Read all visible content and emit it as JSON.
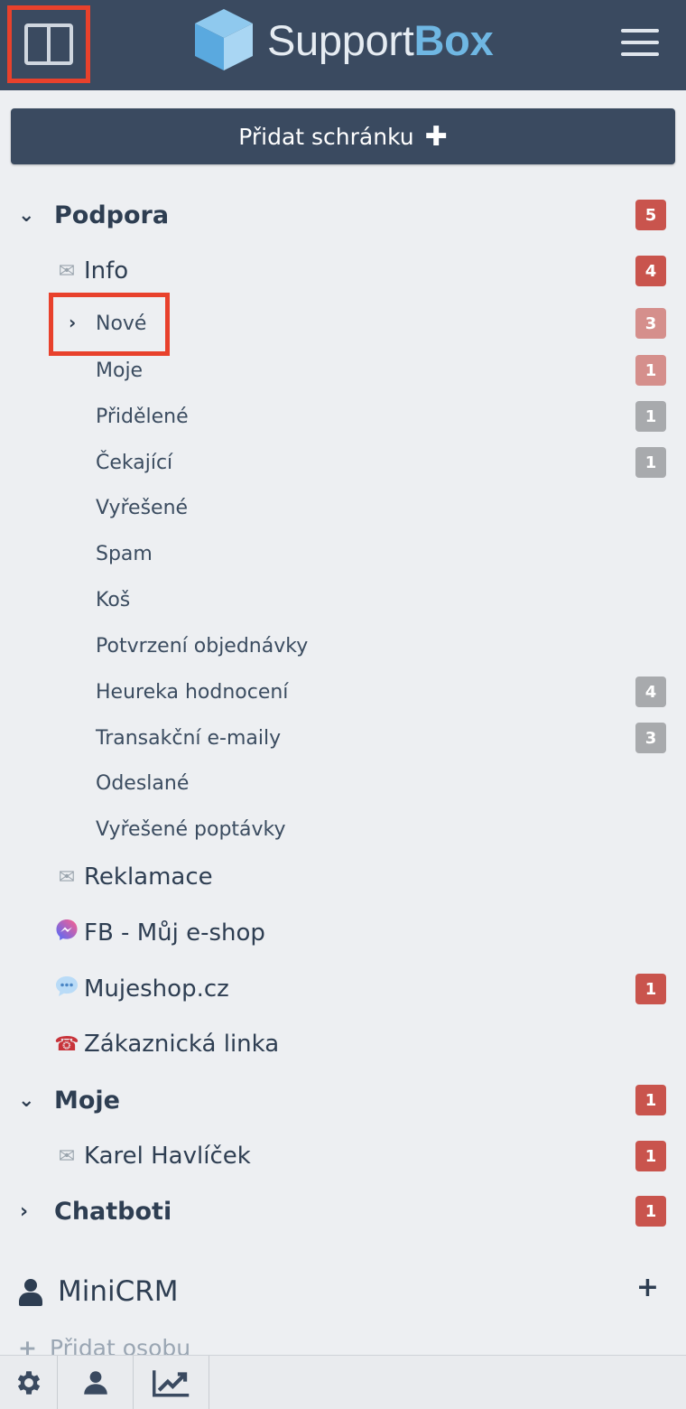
{
  "header": {
    "logo_text_light": "Support",
    "logo_text_bold": "Box"
  },
  "add_mailbox_label": "Přidat schránku",
  "groups": {
    "podpora": {
      "label": "Podpora",
      "count": "5"
    },
    "moje": {
      "label": "Moje",
      "count": "1"
    },
    "chatboti": {
      "label": "Chatboti",
      "count": "1"
    }
  },
  "inboxes": {
    "info": {
      "label": "Info",
      "count": "4"
    },
    "reklamace": {
      "label": "Reklamace"
    },
    "fb": {
      "label": "FB - Můj e-shop"
    },
    "mujeshop": {
      "label": "Mujeshop.cz",
      "count": "1"
    },
    "linka": {
      "label": "Zákaznická linka"
    },
    "karel": {
      "label": "Karel Havlíček",
      "count": "1"
    }
  },
  "folders": [
    {
      "label": "Nové",
      "count": "3"
    },
    {
      "label": "Moje",
      "count": "1"
    },
    {
      "label": "Přidělené",
      "count": "1"
    },
    {
      "label": "Čekající",
      "count": "1"
    },
    {
      "label": "Vyřešené"
    },
    {
      "label": "Spam"
    },
    {
      "label": "Koš"
    },
    {
      "label": "Potvrzení objednávky"
    },
    {
      "label": "Heureka hodnocení",
      "count": "4"
    },
    {
      "label": "Transakční e-maily",
      "count": "3"
    },
    {
      "label": "Odeslané"
    },
    {
      "label": "Vyřešené poptávky"
    }
  ],
  "minicrm": {
    "label": "MiniCRM",
    "add_person": "Přidat osobu"
  },
  "colors": {
    "header_bg": "#3a4a60",
    "badge_red": "#c9544d",
    "badge_pink": "#d58f8c",
    "badge_gray": "#a8aaad",
    "highlight": "#e8412c"
  },
  "icons": [
    "panel-toggle-icon",
    "menu-icon",
    "plus-icon",
    "chevron-down-icon",
    "chevron-right-icon",
    "envelope-icon",
    "messenger-icon",
    "chat-bubble-icon",
    "telephone-icon",
    "person-icon",
    "gear-icon",
    "chart-icon"
  ]
}
